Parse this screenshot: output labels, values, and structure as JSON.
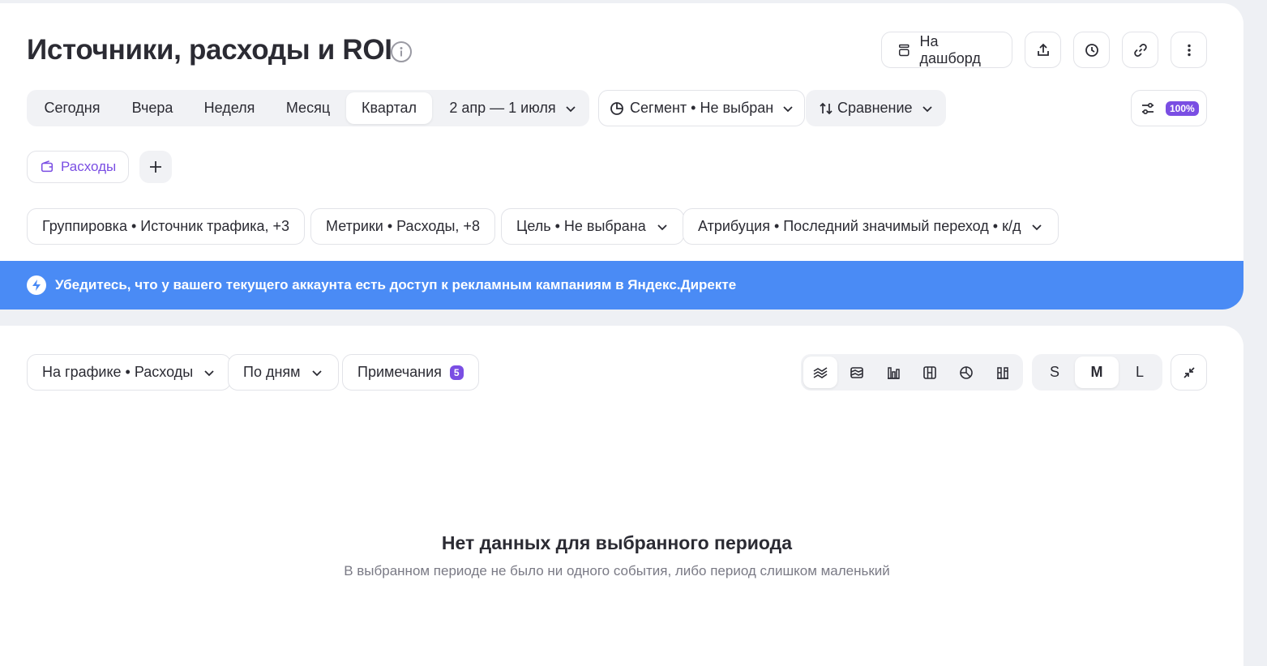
{
  "header": {
    "title": "Источники, расходы и ROI",
    "dashboard_label": "На дашборд",
    "zoom": "100%"
  },
  "period": {
    "items": [
      "Сегодня",
      "Вчера",
      "Неделя",
      "Месяц",
      "Квартал"
    ],
    "active": "Квартал",
    "range": "2 апр — 1 июля"
  },
  "segment_label": "Сегмент • Не выбран",
  "compare_label": "Сравнение",
  "report_tag": "Расходы",
  "filters": {
    "grouping": "Группировка • Источник трафика, +3",
    "metrics": "Метрики • Расходы, +8",
    "goal": "Цель • Не выбрана",
    "attribution": "Атрибуция • Последний значимый переход • к/д"
  },
  "banner_text": "Убедитесь, что у вашего текущего аккаунта есть доступ к рекламным кампаниям в Яндекс.Директе",
  "chart_controls": {
    "on_chart": "На графике • Расходы",
    "by_days": "По дням",
    "notes_label": "Примечания",
    "notes_count": "5",
    "chart_types": [
      "line-chart-icon",
      "stacked-area-icon",
      "bar-chart-icon",
      "column-grid-icon",
      "pie-chart-icon",
      "stacked-bar-icon"
    ],
    "sizes": [
      "S",
      "M",
      "L"
    ],
    "active_size": "M"
  },
  "empty_state": {
    "title": "Нет данных для выбранного периода",
    "subtitle": "В выбранном периоде не было ни одного события, либо период слишком маленький"
  },
  "colors": {
    "accent": "#7a4ee3",
    "banner": "#4a8bf5",
    "background": "#eef0f4"
  }
}
